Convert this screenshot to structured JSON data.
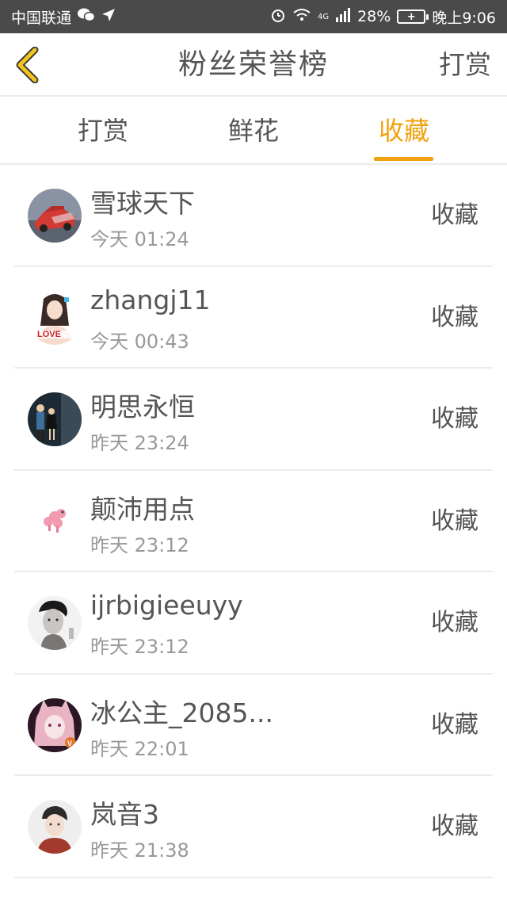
{
  "statusbar": {
    "carrier": "中国联通",
    "network": "4G",
    "battery": "28%",
    "time": "晚上9:06",
    "battery_icon": "+"
  },
  "navbar": {
    "title": "粉丝荣誉榜",
    "action": "打赏"
  },
  "tabs": [
    {
      "label": "打赏",
      "active": false
    },
    {
      "label": "鲜花",
      "active": false
    },
    {
      "label": "收藏",
      "active": true
    }
  ],
  "accent_color": "#f0a10d",
  "list": [
    {
      "name": "雪球天下",
      "time": "今天 01:24",
      "action": "收藏"
    },
    {
      "name": "zhangj11",
      "time": "今天 00:43",
      "action": "收藏"
    },
    {
      "name": "明思永恒",
      "time": "昨天 23:24",
      "action": "收藏"
    },
    {
      "name": "颠沛用点",
      "time": "昨天 23:12",
      "action": "收藏"
    },
    {
      "name": "ijrbigieeuyy",
      "time": "昨天 23:12",
      "action": "收藏"
    },
    {
      "name": "冰公主_2085...",
      "time": "昨天 22:01",
      "action": "收藏"
    },
    {
      "name": "岚音3",
      "time": "昨天 21:38",
      "action": "收藏"
    }
  ]
}
